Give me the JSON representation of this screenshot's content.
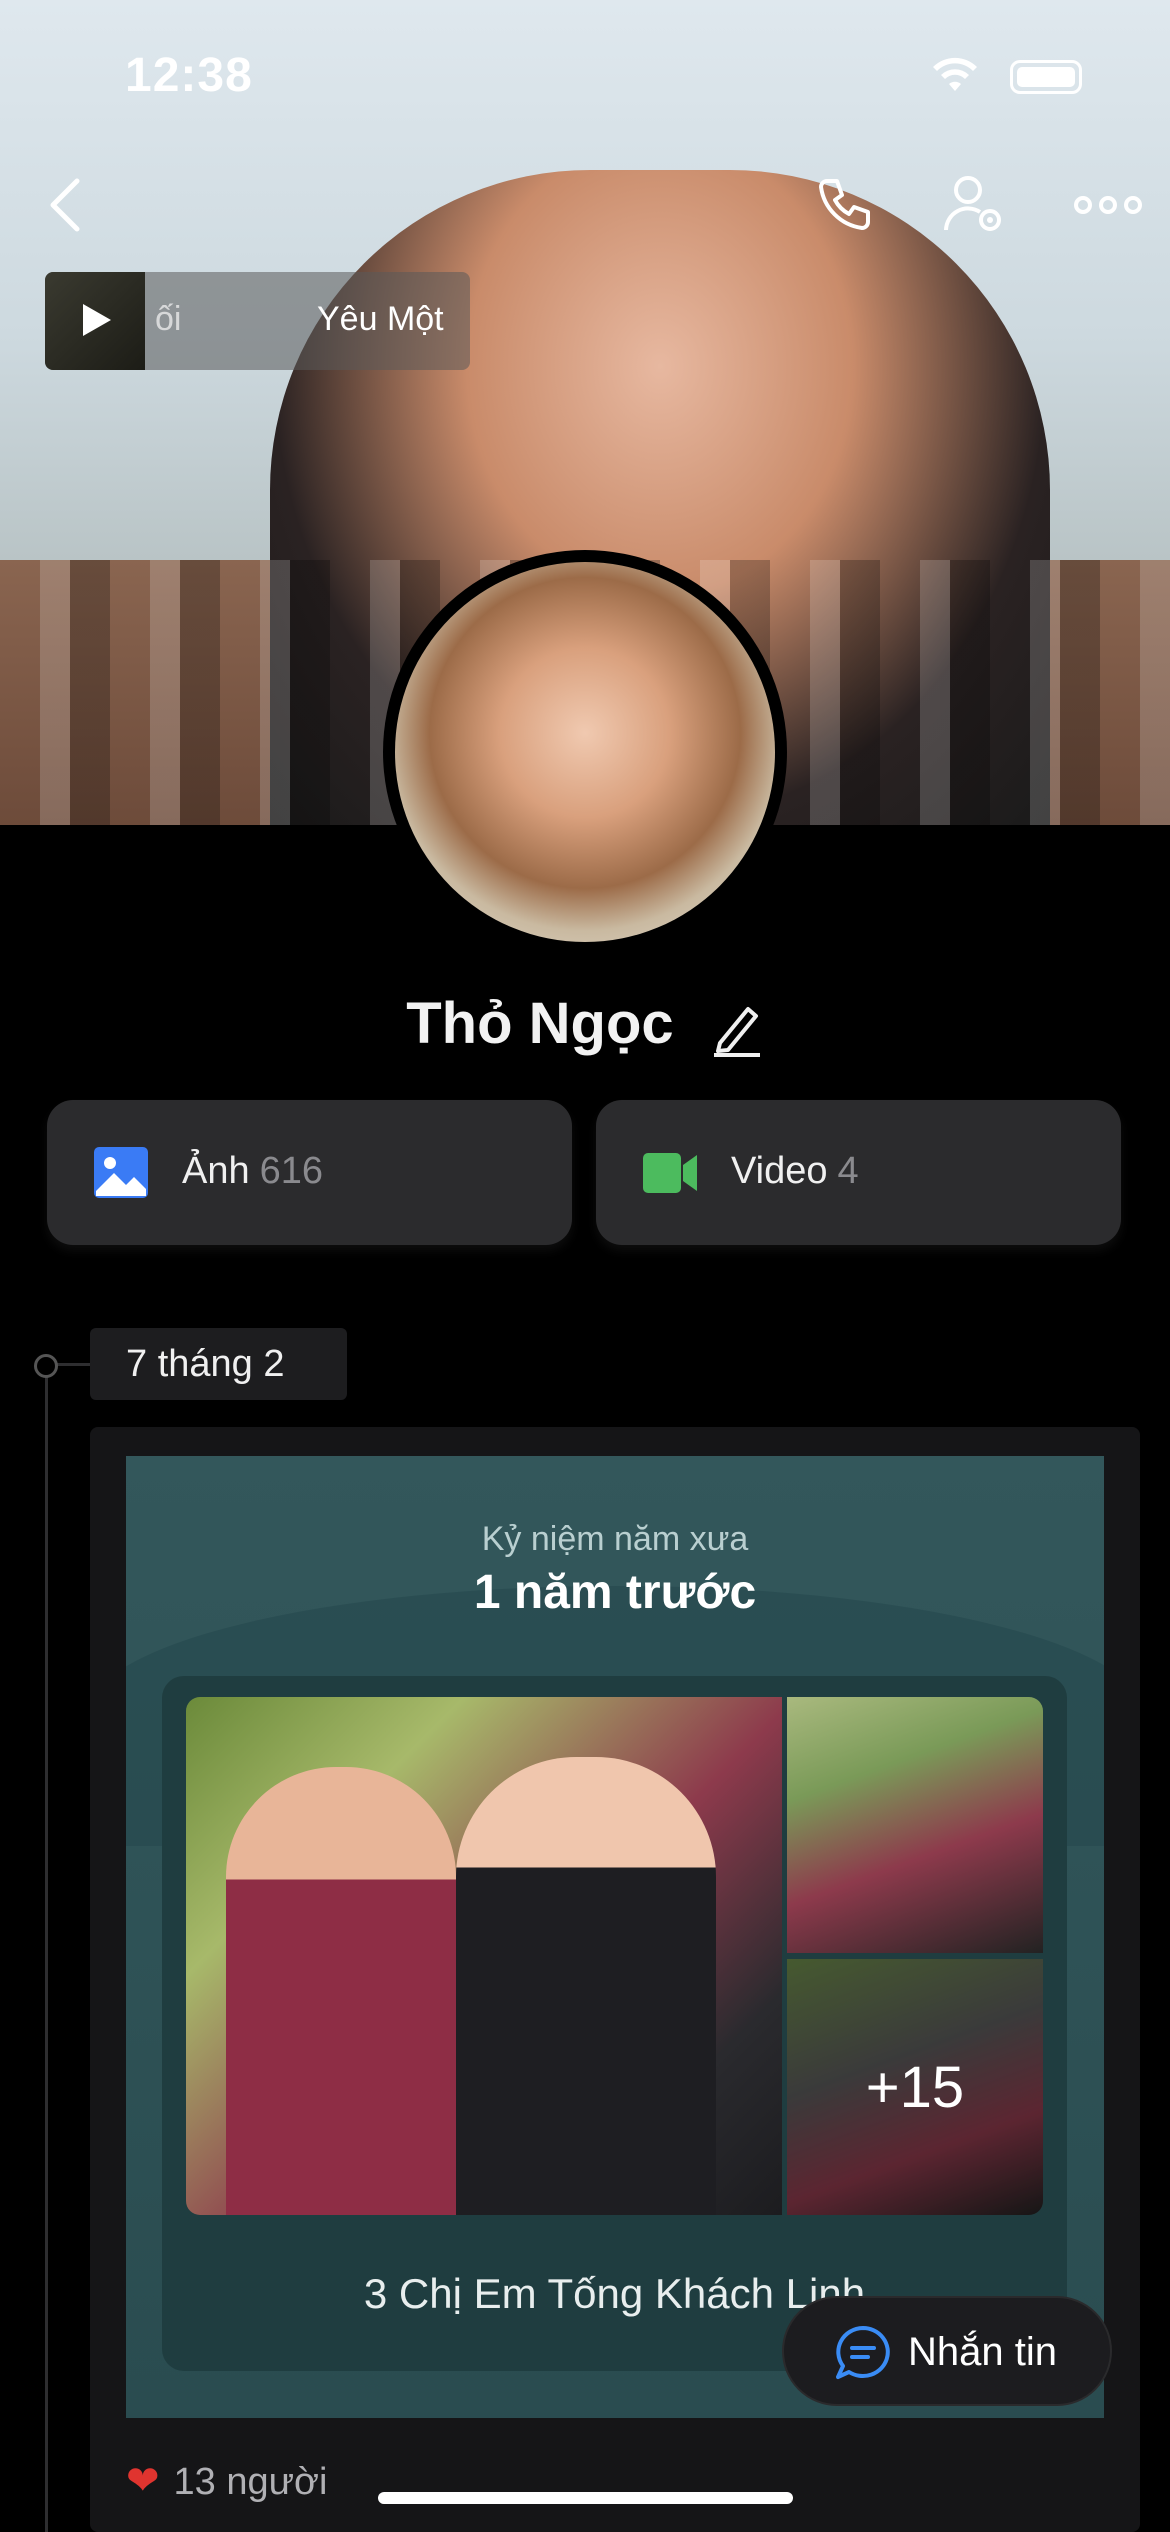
{
  "status_bar": {
    "time": "12:38"
  },
  "music": {
    "title_left": "ối",
    "title_right": "Yêu Một"
  },
  "profile": {
    "name": "Thỏ Ngọc"
  },
  "media_tiles": [
    {
      "label": "Ảnh",
      "count": "616",
      "icon": "image-icon",
      "color": "#3a7bf5"
    },
    {
      "label": "Video",
      "count": "4",
      "icon": "video-camera-icon",
      "color": "#4cbb5e"
    }
  ],
  "timeline": {
    "date": "7 tháng 2",
    "memory": {
      "subtitle": "Kỷ niệm năm xưa",
      "title": "1 năm trước",
      "album_name": "3 Chị Em Tống Khách Linh",
      "more_count": "+15"
    },
    "likes": "13 người"
  },
  "message_button": {
    "label": "Nhắn tin"
  }
}
